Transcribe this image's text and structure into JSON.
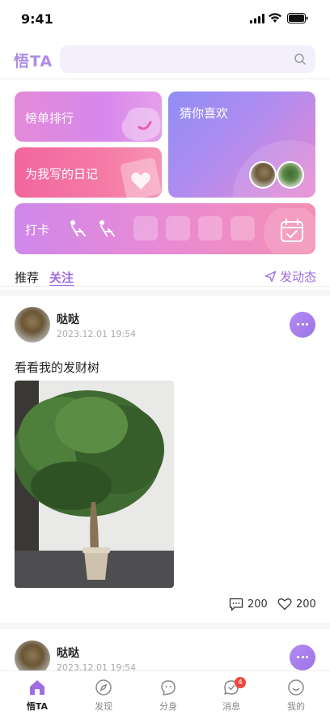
{
  "status": {
    "time": "9:41"
  },
  "header": {
    "brand": "悟TA",
    "search_placeholder": ""
  },
  "cards": {
    "rank": "榜单排行",
    "diary": "为我写的日记",
    "guess": "猜你喜欢",
    "checkin": "打卡"
  },
  "tabs": {
    "recommend": "推荐",
    "follow": "关注",
    "post_button": "发动态"
  },
  "posts": [
    {
      "name": "哒哒",
      "time": "2023.12.01 19:54",
      "text": "看看我的发财树",
      "comments": "200",
      "likes": "200"
    },
    {
      "name": "哒哒",
      "time": "2023.12.01 19:54"
    }
  ],
  "nav": [
    {
      "label": "悟TA",
      "icon": "home-icon",
      "active": true
    },
    {
      "label": "发现",
      "icon": "compass-icon"
    },
    {
      "label": "分身",
      "icon": "avatar-face-icon"
    },
    {
      "label": "消息",
      "icon": "message-icon",
      "badge": "4"
    },
    {
      "label": "我的",
      "icon": "profile-icon"
    }
  ],
  "colors": {
    "accent": "#a06be3",
    "badge": "#f0453a"
  }
}
